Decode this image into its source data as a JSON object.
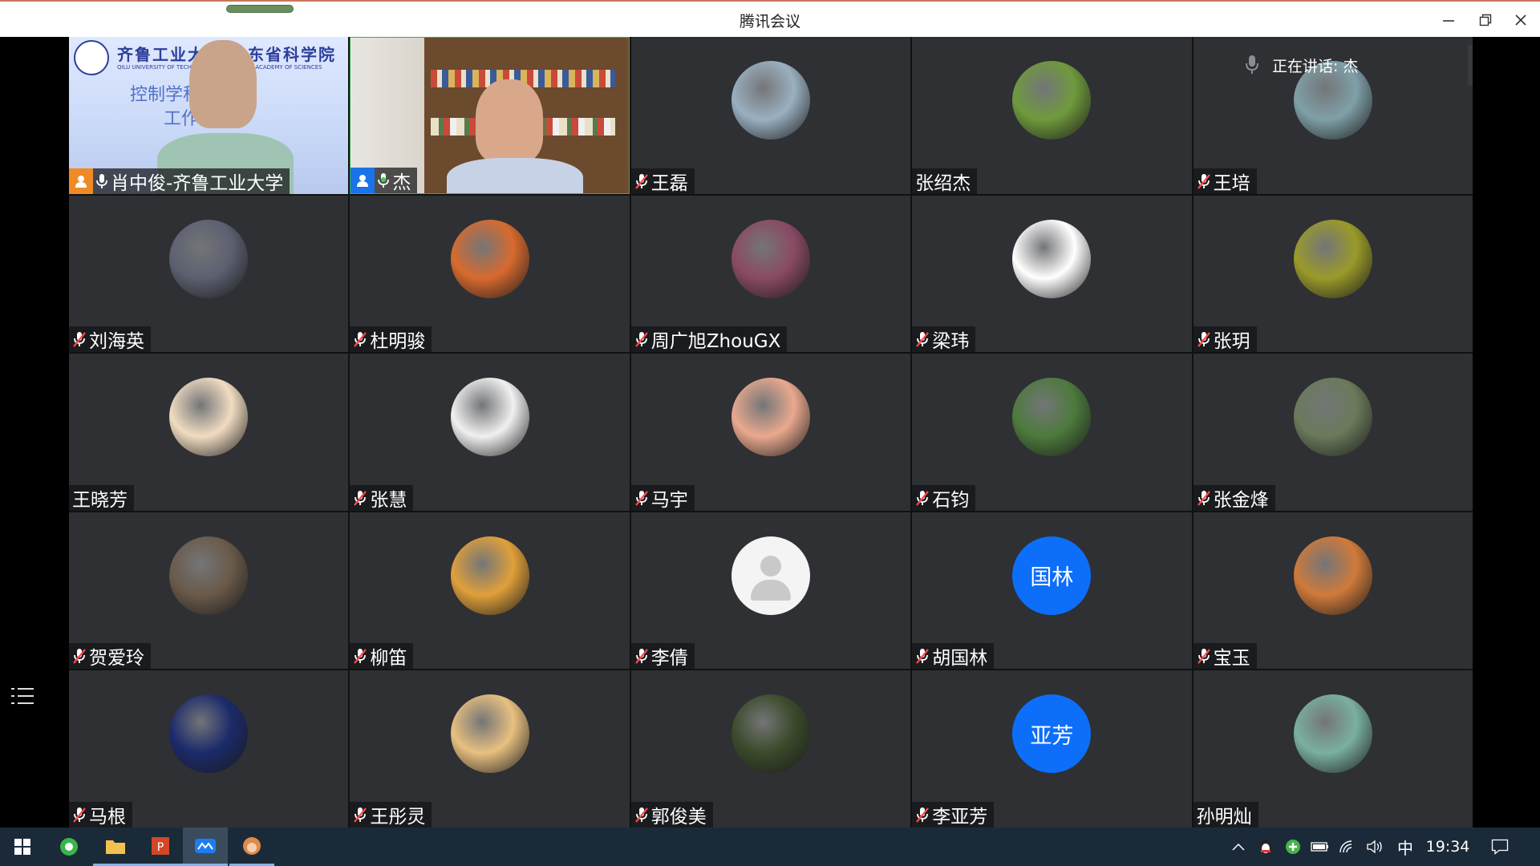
{
  "window": {
    "title": "腾讯会议"
  },
  "speaking": {
    "label": "正在讲话: 杰"
  },
  "participants": [
    {
      "name": "肖中俊-齐鲁工业大学",
      "type": "video-a",
      "mic": "active",
      "host": true
    },
    {
      "name": "杰",
      "type": "video-b",
      "mic": "active-green",
      "host": true
    },
    {
      "name": "王磊",
      "type": "avatar",
      "mic": "muted",
      "avatar_color": "#9ab0c0"
    },
    {
      "name": "张绍杰",
      "type": "avatar",
      "mic": "none",
      "avatar_color": "#6f9a3c"
    },
    {
      "name": "王培",
      "type": "avatar",
      "mic": "muted",
      "avatar_color": "#7fa0a8"
    },
    {
      "name": "刘海英",
      "type": "avatar",
      "mic": "muted",
      "avatar_color": "#5c6070"
    },
    {
      "name": "杜明骏",
      "type": "avatar",
      "mic": "muted",
      "avatar_color": "#d86a2e"
    },
    {
      "name": "周广旭ZhouGX",
      "type": "avatar",
      "mic": "muted",
      "avatar_color": "#8a4a64"
    },
    {
      "name": "梁玮",
      "type": "avatar",
      "mic": "muted",
      "avatar_color": "#ffffff"
    },
    {
      "name": "张玥",
      "type": "avatar",
      "mic": "muted",
      "avatar_color": "#9a9a2a"
    },
    {
      "name": "王晓芳",
      "type": "avatar",
      "mic": "none",
      "avatar_color": "#f1dcc2"
    },
    {
      "name": "张慧",
      "type": "avatar",
      "mic": "muted",
      "avatar_color": "#f0f0f0"
    },
    {
      "name": "马宇",
      "type": "avatar",
      "mic": "muted",
      "avatar_color": "#e9a98e"
    },
    {
      "name": "石钧",
      "type": "avatar",
      "mic": "muted",
      "avatar_color": "#4c7a3c"
    },
    {
      "name": "张金烽",
      "type": "avatar",
      "mic": "muted",
      "avatar_color": "#6a7a5a"
    },
    {
      "name": "贺爱玲",
      "type": "avatar",
      "mic": "muted",
      "avatar_color": "#6a5a4a"
    },
    {
      "name": "柳笛",
      "type": "avatar",
      "mic": "muted",
      "avatar_color": "#e0a03a"
    },
    {
      "name": "李倩",
      "type": "placeholder",
      "mic": "muted"
    },
    {
      "name": "胡国林",
      "type": "text",
      "mic": "muted",
      "avatar_text": "国林"
    },
    {
      "name": "宝玉",
      "type": "avatar",
      "mic": "muted",
      "avatar_color": "#d07a3a"
    },
    {
      "name": "马根",
      "type": "avatar",
      "mic": "muted",
      "avatar_color": "#1b2a6a"
    },
    {
      "name": "王彤灵",
      "type": "avatar",
      "mic": "muted",
      "avatar_color": "#e8c080"
    },
    {
      "name": "郭俊美",
      "type": "avatar",
      "mic": "muted",
      "avatar_color": "#3a4a2a"
    },
    {
      "name": "李亚芳",
      "type": "text",
      "mic": "muted",
      "avatar_text": "亚芳"
    },
    {
      "name": "孙明灿",
      "type": "avatar",
      "mic": "none",
      "avatar_color": "#7ab0a0"
    }
  ],
  "video_a": {
    "banner": "齐鲁工业大学 山东省科学院",
    "banner_sub": "QILU UNIVERSITY OF TECHNOLOGY · SHANDONG ACADEMY OF SCIENCES",
    "slide_line1": "控制学科 招生",
    "slide_line2": "工作"
  },
  "taskbar": {
    "clock": "19:34",
    "ime": "中"
  }
}
